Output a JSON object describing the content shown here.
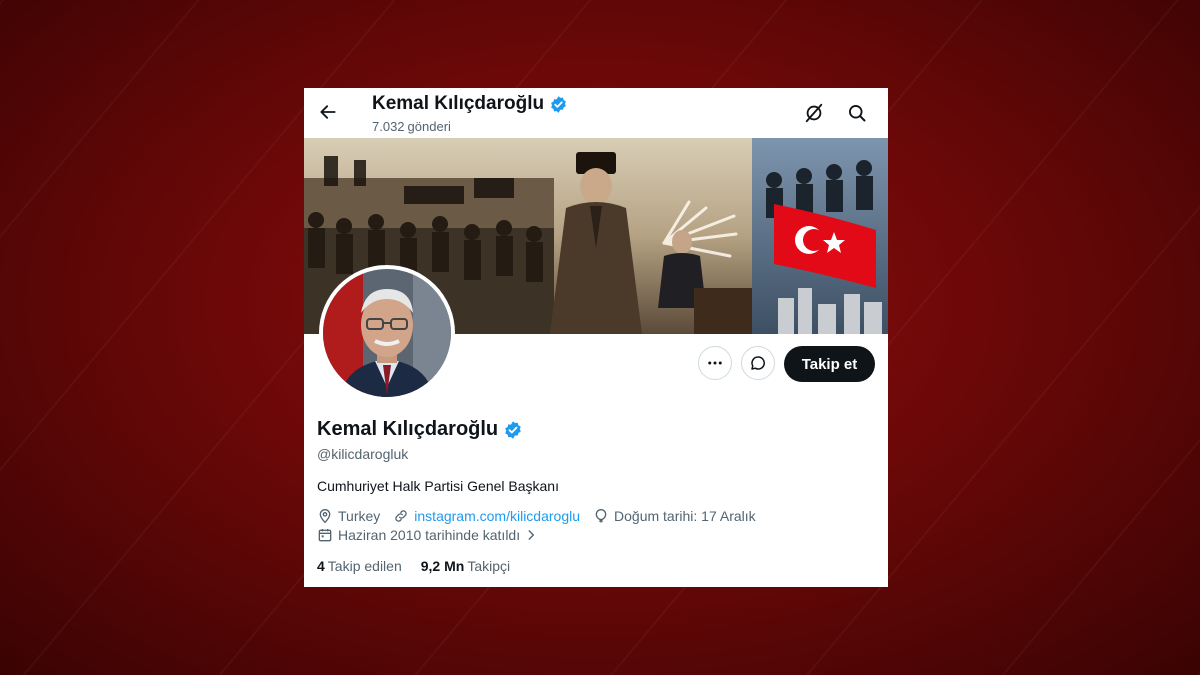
{
  "header": {
    "name": "Kemal Kılıçdaroğlu",
    "post_count": "7.032",
    "post_label": "gönderi",
    "back_icon": "arrow-left-icon",
    "grok_icon": "grok-icon",
    "search_icon": "search-icon"
  },
  "profile": {
    "name": "Kemal Kılıçdaroğlu",
    "handle": "@kilicdarogluk",
    "bio": "Cumhuriyet Halk Partisi Genel Başkanı",
    "location": "Turkey",
    "website": "instagram.com/kilicdaroglu",
    "birth": "Doğum tarihi: 17 Aralık",
    "joined": "Haziran 2010 tarihinde katıldı",
    "following_count": "4",
    "following_label": "Takip edilen",
    "followers_count": "9,2 Mn",
    "followers_label": "Takipçi"
  },
  "actions": {
    "follow_label": "Takip et",
    "more_icon": "more-icon",
    "message_icon": "message-icon"
  },
  "colors": {
    "background": "#7a0a0a",
    "accent_blue": "#1d9bf0",
    "follow_button": "#0f1419",
    "secondary_text": "#536471"
  }
}
